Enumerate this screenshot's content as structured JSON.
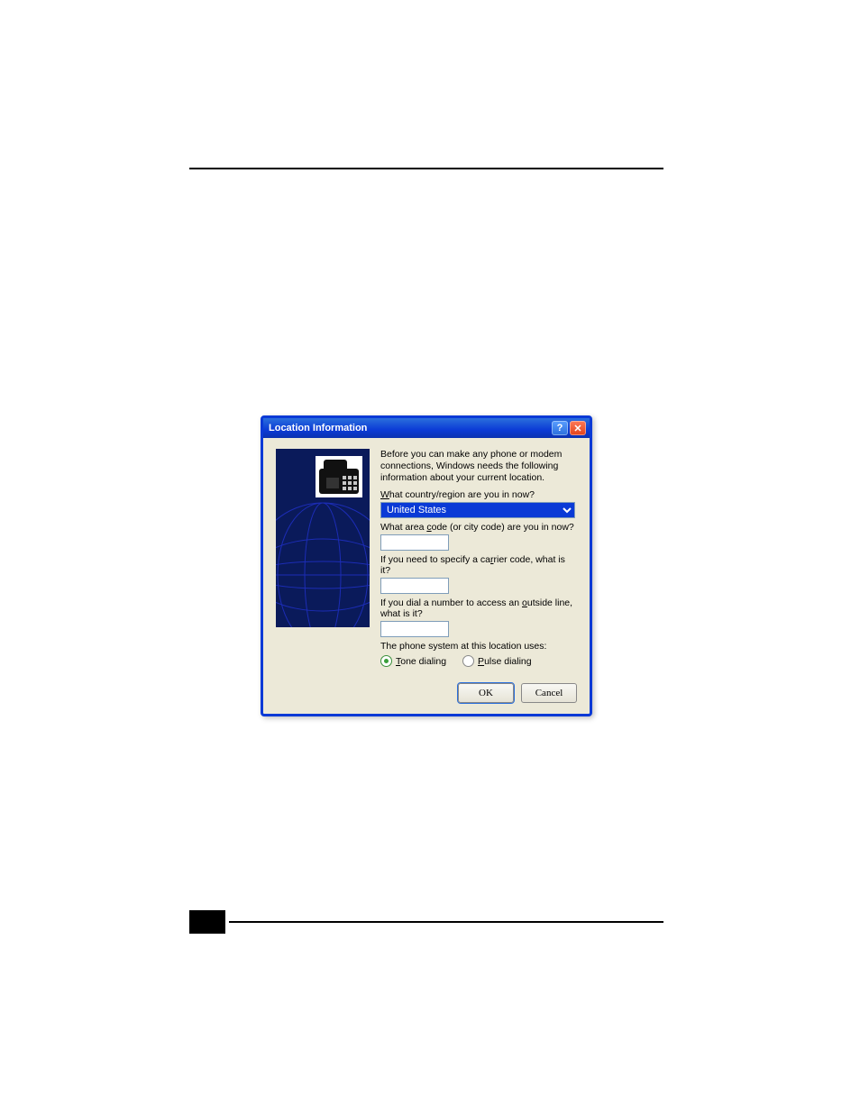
{
  "dialog": {
    "title": "Location Information",
    "intro": "Before you can make any phone or modem connections, Windows needs the following information about your current location.",
    "labels": {
      "country_u": "W",
      "country_rest": "hat country/region are you in now?",
      "area_pre": "What area ",
      "area_u": "c",
      "area_post": "ode (or city code) are you in now?",
      "carrier_pre": "If you need to specify a ca",
      "carrier_u": "r",
      "carrier_post": "rier code, what is it?",
      "outside_pre": "If you dial a number to access an ",
      "outside_u": "o",
      "outside_post": "utside line, what is it?",
      "phone_system": "The phone system at this location uses:"
    },
    "values": {
      "country": "United States",
      "area_code": "",
      "carrier_code": "",
      "outside_line": ""
    },
    "radios": {
      "tone_u": "T",
      "tone_rest": "one dialing",
      "pulse_u": "P",
      "pulse_rest": "ulse dialing",
      "selected": "tone"
    },
    "buttons": {
      "ok": "OK",
      "cancel": "Cancel"
    }
  }
}
